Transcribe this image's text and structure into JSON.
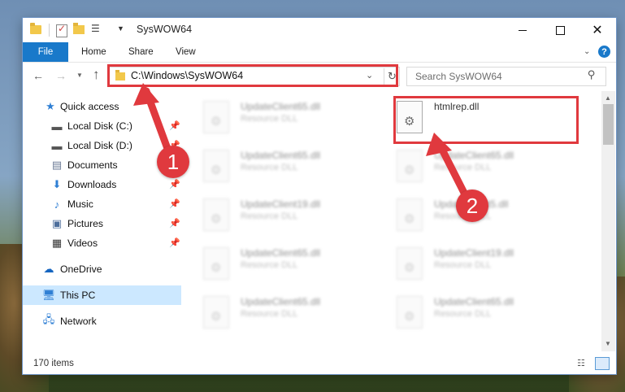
{
  "window": {
    "title": "SysWOW64"
  },
  "ribbon": {
    "tabs": [
      "File",
      "Home",
      "Share",
      "View"
    ],
    "help_label": "?"
  },
  "address": {
    "path": "C:\\Windows\\SysWOW64"
  },
  "search": {
    "placeholder": "Search SysWOW64"
  },
  "nav_pane": {
    "items": [
      {
        "label": "Quick access",
        "icon": "star-icon"
      },
      {
        "label": "Local Disk (C:)",
        "icon": "drive-icon",
        "pinned": true
      },
      {
        "label": "Local Disk (D:)",
        "icon": "drive-icon",
        "pinned": true
      },
      {
        "label": "Documents",
        "icon": "documents-icon",
        "pinned": true
      },
      {
        "label": "Downloads",
        "icon": "downloads-icon",
        "pinned": true
      },
      {
        "label": "Music",
        "icon": "music-icon",
        "pinned": true
      },
      {
        "label": "Pictures",
        "icon": "pictures-icon",
        "pinned": true
      },
      {
        "label": "Videos",
        "icon": "videos-icon",
        "pinned": true
      },
      {
        "label": "OneDrive",
        "icon": "onedrive-icon"
      },
      {
        "label": "This PC",
        "icon": "computer-icon",
        "selected": true
      },
      {
        "label": "Network",
        "icon": "network-icon"
      }
    ]
  },
  "files": [
    {
      "name": "UpdateClient65.dll",
      "type": "Resource DLL"
    },
    {
      "name": "htmlrep.dll",
      "type": "",
      "highlighted": true
    },
    {
      "name": "UpdateClient65.dll",
      "type": "Resource DLL"
    },
    {
      "name": "UpdateClient65.dll",
      "type": "Resource DLL"
    },
    {
      "name": "UpdateClient19.dll",
      "type": "Resource DLL"
    },
    {
      "name": "UpdateClient5.dll",
      "type": "Resource DLL"
    },
    {
      "name": "UpdateClient65.dll",
      "type": "Resource DLL"
    },
    {
      "name": "UpdateClient19.dll",
      "type": "Resource DLL"
    },
    {
      "name": "UpdateClient65.dll",
      "type": "Resource DLL"
    },
    {
      "name": "UpdateClient65.dll",
      "type": "Resource DLL"
    }
  ],
  "status": {
    "item_count": "170 items"
  },
  "annotations": {
    "step1": "1",
    "step2": "2",
    "color": "#e0393e"
  }
}
